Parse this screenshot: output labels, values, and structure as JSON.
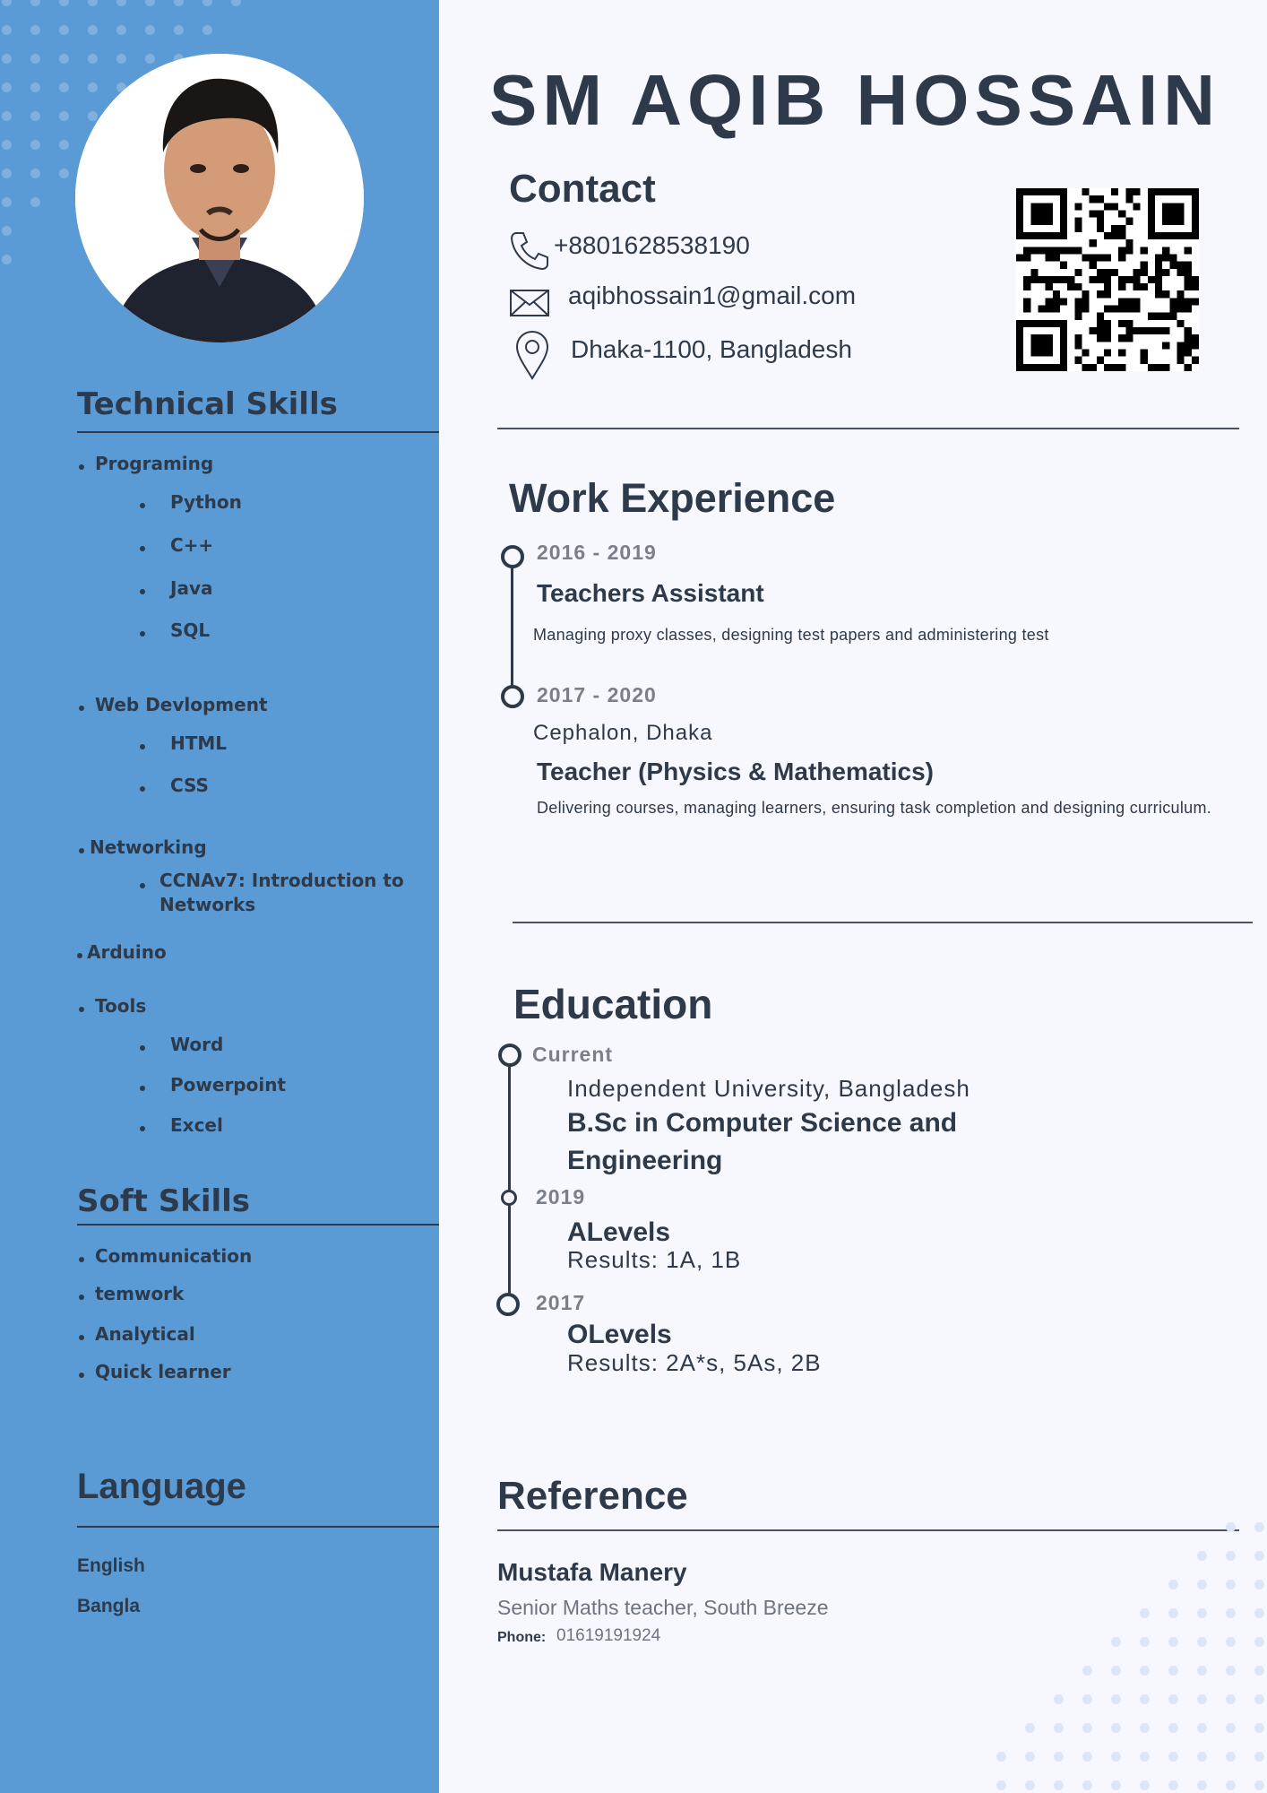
{
  "name": "SM AQIB HOSSAIN",
  "contact": {
    "heading": "Contact",
    "phone": "+8801628538190",
    "email": "aqibhossain1@gmail.com",
    "location": "Dhaka-1100, Bangladesh"
  },
  "technical_skills": {
    "heading": "Technical Skills",
    "programming": {
      "label": "Programing",
      "items": [
        "Python",
        "C++",
        "Java",
        "SQL"
      ]
    },
    "web": {
      "label": "Web Devlopment",
      "items": [
        "HTML",
        "CSS"
      ]
    },
    "networking": {
      "label": "Networking",
      "item_line1": "CCNAv7: Introduction to",
      "item_line2": "Networks"
    },
    "arduino": "Arduino",
    "tools": {
      "label": "Tools",
      "items": [
        "Word",
        "Powerpoint",
        "Excel"
      ]
    }
  },
  "soft_skills": {
    "heading": "Soft Skills",
    "items": [
      "Communication",
      "temwork",
      "Analytical",
      "Quick learner"
    ]
  },
  "language": {
    "heading": "Language",
    "items": [
      "English",
      "Bangla"
    ]
  },
  "work": {
    "heading": "Work Experience",
    "jobs": [
      {
        "dates": "2016 - 2019",
        "role": "Teachers Assistant",
        "desc": "Managing proxy classes, designing test papers and administering test"
      },
      {
        "dates": "2017 - 2020",
        "org": "Cephalon, Dhaka",
        "role": "Teacher (Physics & Mathematics)",
        "desc": "Delivering courses, managing learners, ensuring task completion and designing curriculum."
      }
    ]
  },
  "education": {
    "heading": "Education",
    "items": [
      {
        "date": "Current",
        "school": "Independent University, Bangladesh",
        "degree_line1": "B.Sc in Computer Science and",
        "degree_line2": "Engineering"
      },
      {
        "date": "2019",
        "degree": "ALevels",
        "result": "Results: 1A, 1B"
      },
      {
        "date": "2017",
        "degree": "OLevels",
        "result": "Results: 2A*s, 5As, 2B"
      }
    ]
  },
  "reference": {
    "heading": "Reference",
    "name": "Mustafa Manery",
    "title": "Senior Maths teacher, South Breeze",
    "phone_label": "Phone:",
    "phone": "01619191924"
  },
  "colors": {
    "sidebar": "#5b9bd5",
    "text": "#2e3a4a",
    "page": "#f7f8fd"
  }
}
